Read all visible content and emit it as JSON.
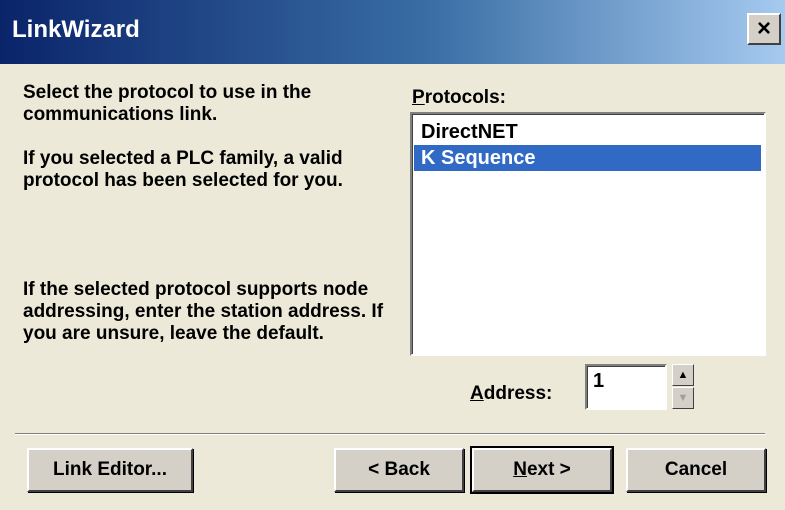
{
  "window": {
    "title": "LinkWizard",
    "close_label": "×"
  },
  "instructions": {
    "p1": "Select the protocol to use in the communications link.",
    "p2": "If you selected a PLC family, a valid protocol has been selected for you.",
    "p3": "If the selected protocol supports node addressing, enter the station address. If you are unsure, leave the default."
  },
  "protocols": {
    "label_mnemonic": "P",
    "label_rest": "rotocols:",
    "items": [
      {
        "label": "DirectNET",
        "selected": false
      },
      {
        "label": "K Sequence",
        "selected": true
      }
    ]
  },
  "address": {
    "label_mnemonic": "A",
    "label_rest": "ddress:",
    "value": "1"
  },
  "buttons": {
    "link_editor": "Link Editor...",
    "back": "< Back",
    "next_mnemonic": "N",
    "next_rest": "ext >",
    "cancel": "Cancel"
  },
  "colors": {
    "title_bar_start": "#0a246a",
    "title_bar_end": "#a6caf0",
    "selection": "#316ac5",
    "dialog_bg": "#ece9d8"
  }
}
